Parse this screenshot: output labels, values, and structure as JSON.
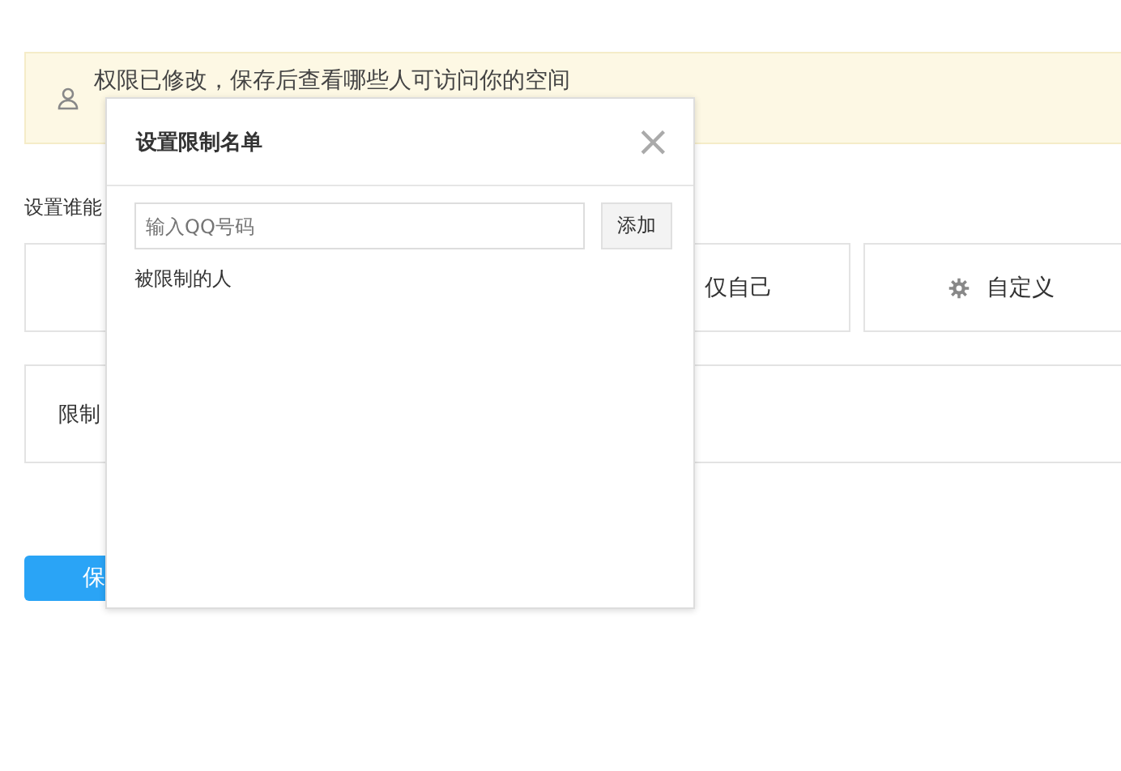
{
  "banner": {
    "text": "权限已修改，保存后查看哪些人可访问你的空间"
  },
  "section_label": "设置谁能",
  "options": [
    {
      "label": "仅自己",
      "kind": "plain"
    },
    {
      "label": "自定义",
      "kind": "gear"
    }
  ],
  "restriction_row": {
    "label": "限制"
  },
  "save_button": "保",
  "dialog": {
    "title": "设置限制名单",
    "close": "×",
    "input": {
      "placeholder": "输入QQ号码"
    },
    "add_button": "添加",
    "list_label": "被限制的人"
  }
}
